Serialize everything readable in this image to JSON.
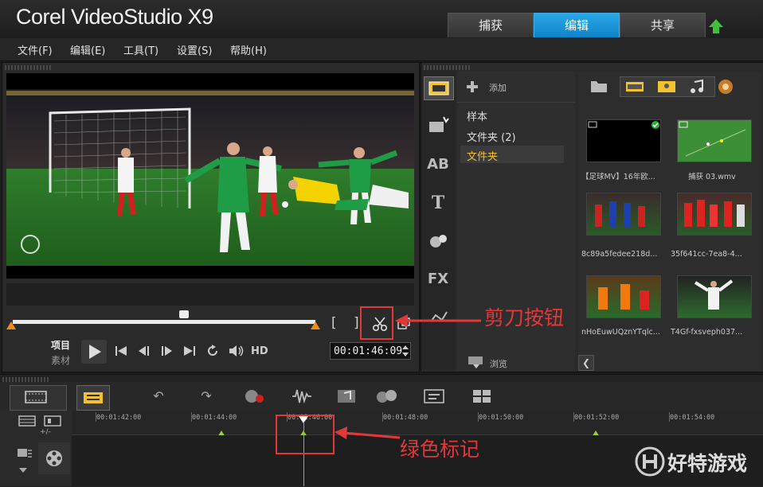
{
  "app": {
    "title": "Corel VideoStudio X9"
  },
  "top_tabs": [
    {
      "label": "捕获"
    },
    {
      "label": "编辑",
      "active": true
    },
    {
      "label": "共享"
    }
  ],
  "menu": [
    "文件(F)",
    "编辑(E)",
    "工具(T)",
    "设置(S)",
    "帮助(H)"
  ],
  "player": {
    "mode_project": "项目",
    "mode_clip": "素材",
    "hd_label": "HD",
    "timecode": "00:01:46:09"
  },
  "library": {
    "add_label": "添加",
    "browse_label": "浏览",
    "folders": [
      "样本",
      "文件夹 (2)",
      "文件夹"
    ],
    "selected_folder_index": 2,
    "thumbnails": [
      {
        "caption": "【足球MV】16年欧..."
      },
      {
        "caption": "捕获 03.wmv"
      },
      {
        "caption": "8c89a5fedee218d..."
      },
      {
        "caption": "35f641cc-7ea8-4..."
      },
      {
        "caption": "nHoEuwUQznYTqlc..."
      },
      {
        "caption": "T4Gf-fxsveph037..."
      }
    ]
  },
  "timeline": {
    "ticks": [
      "00:01:42:00",
      "00:01:44:00",
      "00:01:46:00",
      "00:01:48:00",
      "00:01:50:00",
      "00:01:52:00",
      "00:01:54:00"
    ],
    "zoom_label": "+/-"
  },
  "annotations": {
    "scissors": "剪刀按钮",
    "green_marker": "绿色标记"
  },
  "watermark": {
    "text": "好特游戏"
  },
  "colors": {
    "accent_tab": "#1a96db",
    "annotation": "#e23838",
    "marker": "#8fd23c",
    "trim": "#f08a1c"
  }
}
